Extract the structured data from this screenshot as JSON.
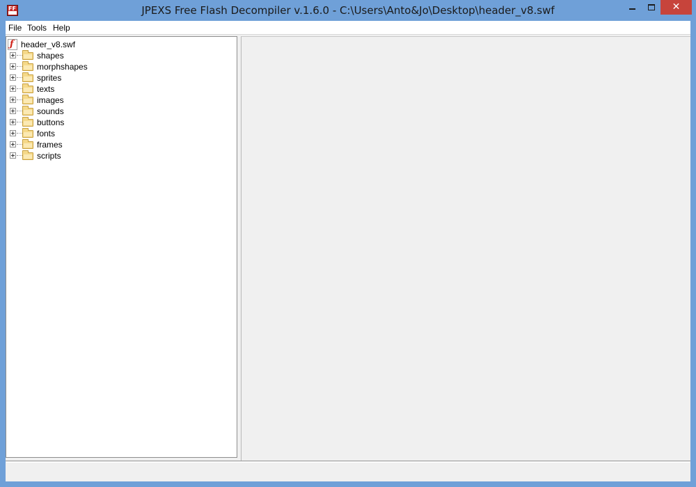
{
  "window": {
    "title": "JPEXS Free Flash Decompiler v.1.6.0 - C:\\Users\\Anto&Jo\\Desktop\\header_v8.swf",
    "app_icon": "ffdec-app-icon",
    "close_glyph": "✕"
  },
  "menu": {
    "file": "File",
    "tools": "Tools",
    "help": "Help"
  },
  "tree": {
    "root": {
      "label": "header_v8.swf",
      "icon": "flash-file-icon"
    },
    "nodes": [
      {
        "label": "shapes",
        "icon": "folder-icon"
      },
      {
        "label": "morphshapes",
        "icon": "folder-icon"
      },
      {
        "label": "sprites",
        "icon": "folder-icon"
      },
      {
        "label": "texts",
        "icon": "folder-icon"
      },
      {
        "label": "images",
        "icon": "folder-icon"
      },
      {
        "label": "sounds",
        "icon": "folder-icon"
      },
      {
        "label": "buttons",
        "icon": "folder-icon"
      },
      {
        "label": "fonts",
        "icon": "folder-icon"
      },
      {
        "label": "frames",
        "icon": "folder-icon"
      },
      {
        "label": "scripts",
        "icon": "folder-icon"
      }
    ]
  },
  "status": {
    "text": ""
  },
  "colors": {
    "titlebar": "#6fa0d8",
    "close_button": "#c7443b",
    "panel_bg": "#f0f0f0",
    "folder": "#f5d98a"
  }
}
